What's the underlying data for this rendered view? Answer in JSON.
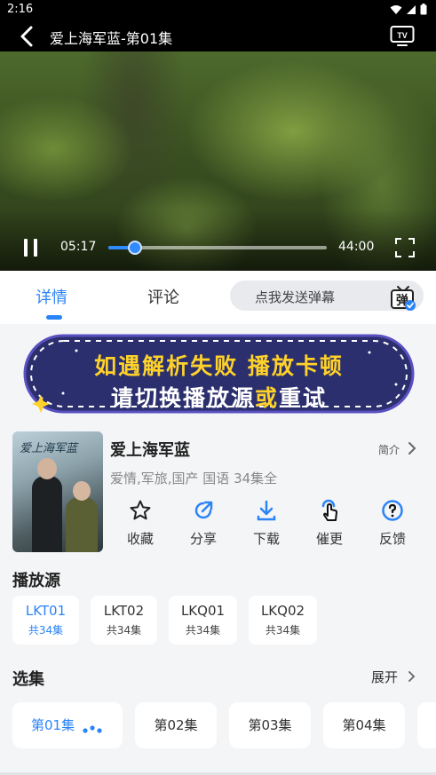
{
  "status": {
    "time": "2:16"
  },
  "player": {
    "title": "爱上海军蓝-第01集",
    "current_time": "05:17",
    "duration": "44:00",
    "progress": 0.12
  },
  "tabs": {
    "detail": "详情",
    "comment": "评论"
  },
  "danmu": {
    "placeholder": "点我发送弹幕",
    "icon_text": "弹"
  },
  "banner": {
    "line1": "如遇解析失败 播放卡顿",
    "line2_a": "请切换播放源",
    "line2_b": "或",
    "line2_c": "重试"
  },
  "show": {
    "poster_title": "爱上海军蓝",
    "title": "爱上海军蓝",
    "intro_label": "简介",
    "meta": "爱情,军旅,国产 国语 34集全"
  },
  "actions": [
    {
      "label": "收藏",
      "icon": "star-icon"
    },
    {
      "label": "分享",
      "icon": "share-icon"
    },
    {
      "label": "下载",
      "icon": "download-icon"
    },
    {
      "label": "催更",
      "icon": "tap-icon"
    },
    {
      "label": "反馈",
      "icon": "help-icon"
    }
  ],
  "sources": {
    "title": "播放源",
    "items": [
      {
        "name": "LKT01",
        "count": "共34集"
      },
      {
        "name": "LKT02",
        "count": "共34集"
      },
      {
        "name": "LKQ01",
        "count": "共34集"
      },
      {
        "name": "LKQ02",
        "count": "共34集"
      }
    ]
  },
  "episodes": {
    "title": "选集",
    "expand_label": "展开",
    "items": [
      "第01集",
      "第02集",
      "第03集",
      "第04集"
    ]
  },
  "colors": {
    "accent": "#2b84f7",
    "banner_yellow": "#ffd229",
    "banner_bg": "#2b2f6e"
  }
}
